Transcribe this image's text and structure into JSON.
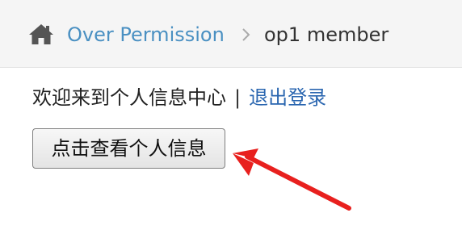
{
  "breadcrumb": {
    "home_icon": "home-icon",
    "link_label": "Over Permission",
    "separator_icon": "chevron-right-icon",
    "current_label": "op1 member"
  },
  "main": {
    "welcome_text": "欢迎来到个人信息中心",
    "divider": "|",
    "logout_label": "退出登录",
    "view_info_button": "点击查看个人信息"
  },
  "annotation": {
    "arrow_color": "#e8201e"
  },
  "colors": {
    "link": "#4a90c2",
    "logout_link": "#2a66b0",
    "header_bg": "#f5f5f5"
  }
}
